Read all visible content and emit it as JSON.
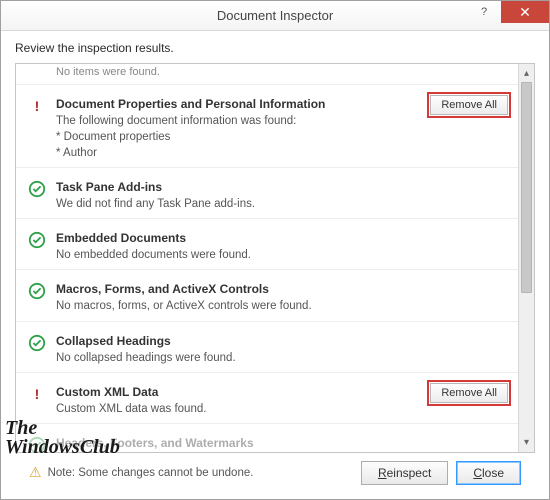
{
  "titlebar": {
    "title": "Document Inspector",
    "close": "✕",
    "help": "?"
  },
  "subheader": "Review the inspection results.",
  "cutoff_top": "No items were found.",
  "sections": {
    "docprops": {
      "title": "Document Properties and Personal Information",
      "line1": "The following document information was found:",
      "line2": "* Document properties",
      "line3": "* Author",
      "action": "Remove All"
    },
    "taskpane": {
      "title": "Task Pane Add-ins",
      "body": "We did not find any Task Pane add-ins."
    },
    "embedded": {
      "title": "Embedded Documents",
      "body": "No embedded documents were found."
    },
    "macros": {
      "title": "Macros, Forms, and ActiveX Controls",
      "body": "No macros, forms, or ActiveX controls were found."
    },
    "collapsed": {
      "title": "Collapsed Headings",
      "body": "No collapsed headings were found."
    },
    "xml": {
      "title": "Custom XML Data",
      "body": "Custom XML data was found.",
      "action": "Remove All"
    },
    "headers": {
      "title": "Headers, Footers, and Watermarks"
    }
  },
  "footer": {
    "note": "Note: Some changes cannot be undone.",
    "reinspect_pre": "",
    "reinspect_u": "R",
    "reinspect_post": "einspect",
    "close_u": "C",
    "close_post": "lose"
  },
  "watermark": {
    "l1": "The",
    "l2": "WindowsClub"
  }
}
